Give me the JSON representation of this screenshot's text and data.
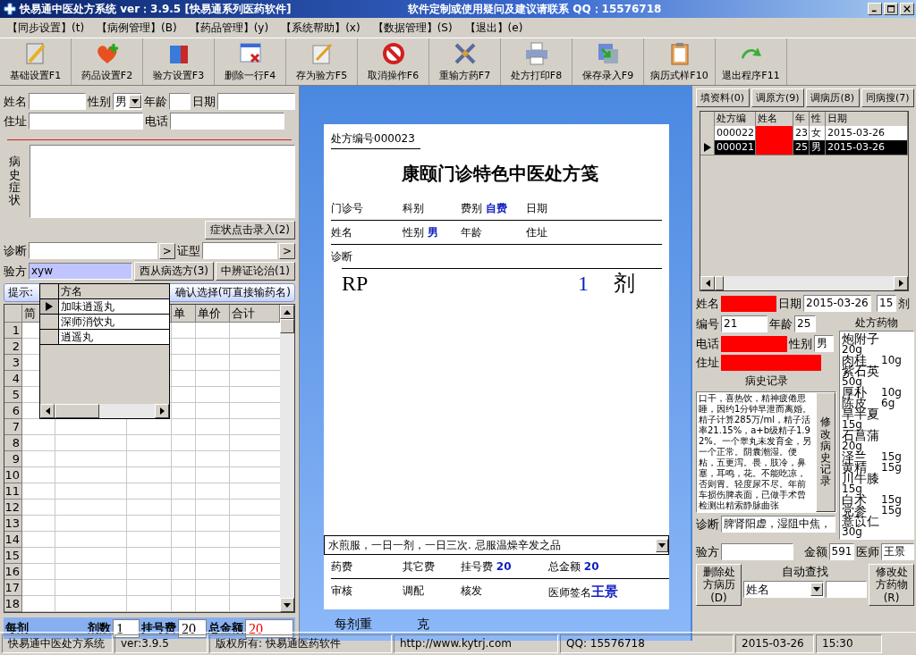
{
  "window": {
    "title": "快易通中医处方系统   ver：3.9.5 [快易通系列医药软件]",
    "contact": "软件定制或使用疑问及建议请联系 QQ：15576718"
  },
  "menu": [
    "【同步设置】(t)",
    "【病例管理】(B)",
    "【药品管理】(y)",
    "【系统帮助】(x)",
    "【数据管理】(S)",
    "【退出】(e)"
  ],
  "toolbar": [
    "基础设置F1",
    "药品设置F2",
    "验方设置F3",
    "删除一行F4",
    "存为验方F5",
    "取消操作F6",
    "重输方药F7",
    "处方打印F8",
    "保存录入F9",
    "病历式样F10",
    "退出程序F11"
  ],
  "patient_form": {
    "name_label": "姓名",
    "sex_label": "性别",
    "sex_value": "男",
    "age_label": "年龄",
    "date_label": "日期",
    "address_label": "住址",
    "phone_label": "电话",
    "history_label": "病史症状",
    "symptom_button": "症状点击录入(2)",
    "diagnosis_label": "诊断",
    "diagnosis_button": ">",
    "syndrome_label": "证型",
    "syndrome_button": ">",
    "formula_label": "验方",
    "formula_value": "xyw",
    "western_button": "西从病选方(3)",
    "tcm_button": "中辨证论治(1)"
  },
  "hint": {
    "prefix": "提示:",
    "suffix": "确认选择(可直接输药名)"
  },
  "formula_popup": {
    "column": "方名",
    "rows": [
      {
        "name": "加味逍遥丸",
        "selected": true
      },
      {
        "name": "深师消饮丸",
        "selected": false
      },
      {
        "name": "逍遥丸",
        "selected": false
      }
    ]
  },
  "drug_grid": {
    "columns": [
      "简",
      "单",
      "单价",
      "合计"
    ],
    "row_numbers": [
      "1",
      "2",
      "3",
      "4",
      "5",
      "6",
      "7",
      "8",
      "9",
      "10",
      "11",
      "12",
      "13",
      "14",
      "15",
      "16",
      "17",
      "18"
    ]
  },
  "totals_bar": {
    "per_dose_label": "每剂",
    "doses_label": "剂数",
    "doses_value": "1",
    "fee_label": "挂号费",
    "fee_value": "20",
    "total_label": "总金额",
    "total_value": "20"
  },
  "prescription": {
    "number_label": "处方编号000023",
    "title": "康颐门诊特色中医处方笺",
    "clinic_no_label": "门诊号",
    "department_label": "科别",
    "fee_type_label": "费别",
    "fee_type_value": "自费",
    "date_label": "日期",
    "name_label": "姓名",
    "sex_label": "性别",
    "sex_value": "男",
    "age_label": "年龄",
    "address_label": "住址",
    "diagnosis_label": "诊断",
    "rp": "RP",
    "dose_count": "1",
    "dose_unit": "剂",
    "usage": "水煎服，一日一剂，一日三次. 忌服温燥辛发之品",
    "drug_fee_label": "药费",
    "other_fee_label": "其它费",
    "reg_fee_label": "挂号费",
    "reg_fee_value": "20",
    "total_label": "总金额",
    "total_value": "20",
    "review_label": "审核",
    "dispense_label": "调配",
    "issue_label": "核发",
    "doctor_label": "医师签名",
    "doctor_value": "王景"
  },
  "dose_weight": {
    "label": "每剂重",
    "unit": "克"
  },
  "right_tabs": [
    "填资料(0)",
    "调原方(9)",
    "调病历(8)",
    "同病搜(7)"
  ],
  "history_grid": {
    "columns": [
      "处方编",
      "姓名",
      "年",
      "性",
      "日期"
    ],
    "rows": [
      {
        "id": "000022",
        "age": "23",
        "sex": "女",
        "date": "2015-03-26",
        "selected": false
      },
      {
        "id": "000021",
        "age": "25",
        "sex": "男",
        "date": "2015-03-26",
        "selected": true
      }
    ]
  },
  "record": {
    "name_label": "姓名",
    "date_label": "日期",
    "date_value": "2015-03-26",
    "doses_value": "15",
    "doses_unit": "剂",
    "number_label": "编号",
    "number_value": "21",
    "age_label": "年龄",
    "age_value": "25",
    "phone_label": "电话",
    "sex_label": "性别",
    "sex_value": "男",
    "address_label": "住址",
    "history_title": "病史记录",
    "history_text": "口干，喜热饮，精神疲倦思睡，因约1分钟早泄而离婚。精子计算285万/ml，精子活率21.15%，a+b级精子1.92%。一个睾丸未发育全，另一个正常。阴囊潮湿。便粘，五更泻。畏，肢冷，鼻塞，耳鸣，花。不能吃凉，否则胃。轻度尿不尽。年前车损伤脾表面，已做手术曾检测出精索静脉曲张",
    "edit_history_button": "修改病史记录",
    "diagnosis_label": "诊断",
    "diagnosis_value": "脾肾阳虚，湿阻中焦，",
    "drugs_title": "处方药物",
    "drugs": [
      {
        "name": "炮附子",
        "dose": "20g"
      },
      {
        "name": "肉桂",
        "dose": "10g"
      },
      {
        "name": "紫石英",
        "dose": "50g"
      },
      {
        "name": "厚朴",
        "dose": "10g"
      },
      {
        "name": "陈皮",
        "dose": "6g"
      },
      {
        "name": "旱半夏",
        "dose": "15g"
      },
      {
        "name": "石菖蒲",
        "dose": "20g"
      },
      {
        "name": "泽兰",
        "dose": "15g"
      },
      {
        "name": "黄精",
        "dose": "15g"
      },
      {
        "name": "川牛膝",
        "dose": "15g"
      },
      {
        "name": "白术",
        "dose": "15g"
      },
      {
        "name": "党参",
        "dose": "15g"
      },
      {
        "name": "薏苡仁",
        "dose": "30g"
      }
    ],
    "formula_label": "验方",
    "amount_label": "金额",
    "amount_value": "591",
    "doctor_label": "医师",
    "doctor_value": "王景",
    "delete_button": "删除处方病历(D)",
    "search_label": "自动查找",
    "search_field": "姓名",
    "modify_button": "修改处方药物(R)"
  },
  "status_bar": [
    "快易通中医处方系统",
    "ver:3.9.5",
    "版权所有: 快易通医药软件",
    "http://www.kytrj.com",
    "QQ: 15576718",
    "2015-03-26",
    "15:30"
  ]
}
